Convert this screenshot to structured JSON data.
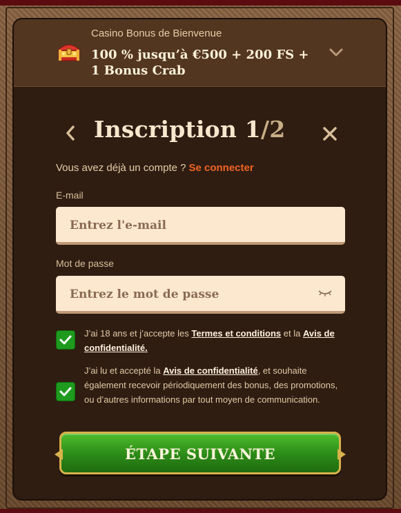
{
  "bonus": {
    "kicker": "Casino Bonus de Bienvenue",
    "offer": "100 % jusqu’à €500 + 200 FS + 1 Bonus Crab",
    "expand_icon": "chevron-down-icon",
    "chest_icon": "treasure-chest-icon"
  },
  "form": {
    "title": "Inscription 1",
    "title_step_total": "/2",
    "back_icon": "chevron-left-icon",
    "close_icon": "close-icon",
    "login_prompt": "Vous avez déjà un compte ?",
    "login_link": "Se connecter",
    "email": {
      "label": "E-mail",
      "placeholder": "Entrez l'e-mail"
    },
    "password": {
      "label": "Mot de passe",
      "placeholder": "Entrez le mot de passe",
      "toggle_icon": "eye-closed-icon"
    },
    "consent_terms": {
      "checked": true,
      "text_before": "J’ai 18 ans et j’accepte les ",
      "link1": "Termes et conditions",
      "text_mid": " et la ",
      "link2": "Avis de confidentialité."
    },
    "consent_marketing": {
      "checked": true,
      "text_before": "J’ai lu et accepté la ",
      "link": "Avis de confidentialité",
      "text_after": ", et souhaite également recevoir périodiquement des bonus, des promotions, ou d’autres informations par tout moyen de communication."
    },
    "submit_label": "ÉTAPE SUIVANTE"
  },
  "colors": {
    "background": "#2f1d12",
    "header": "#533620",
    "accent_link": "#f26322",
    "input_bg": "#fbe8cf",
    "cta_green": "#2b8a17",
    "cta_border": "#d8b24c",
    "checkbox": "#1e9a1e"
  }
}
